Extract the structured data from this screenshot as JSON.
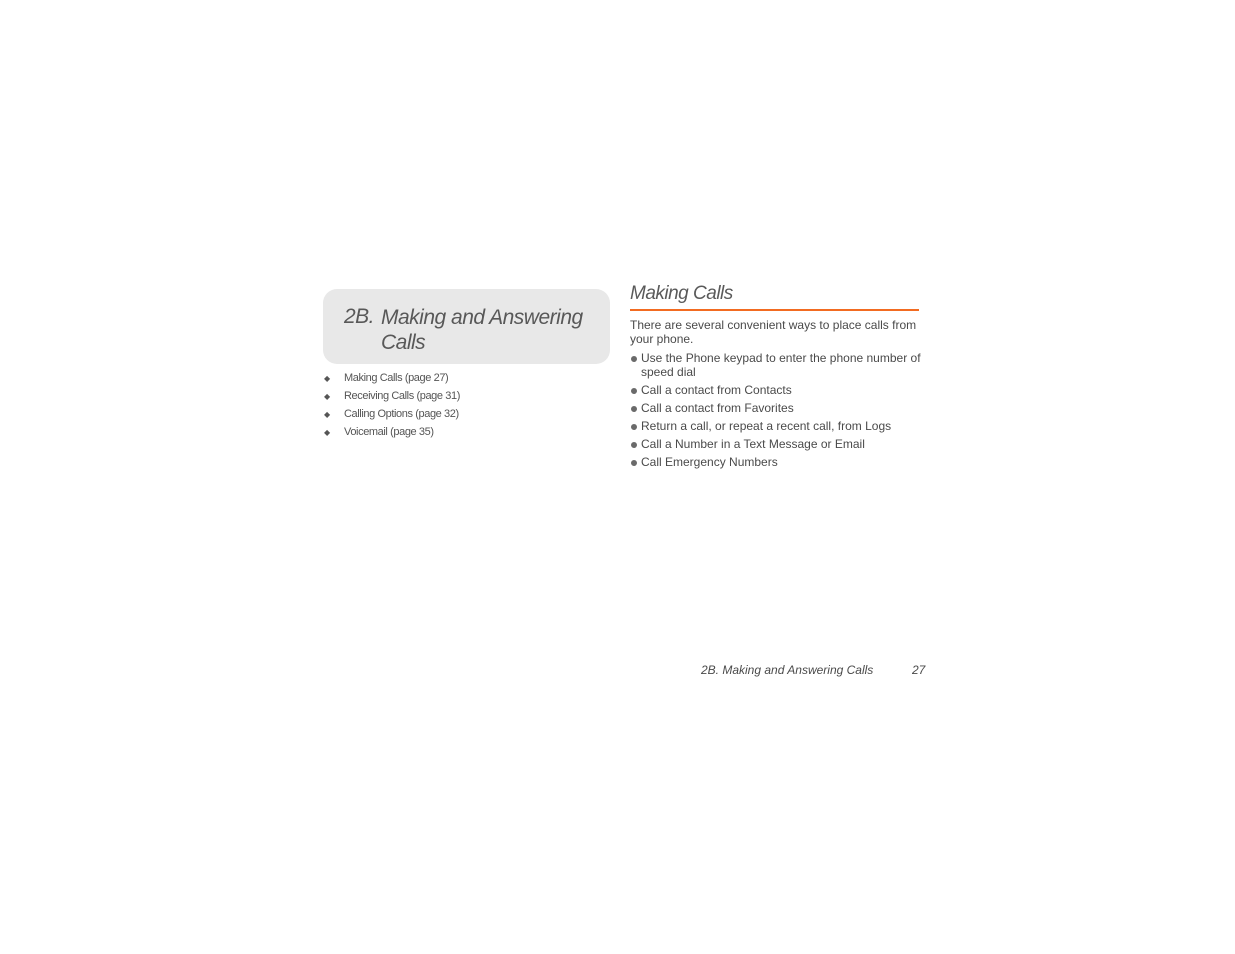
{
  "chapter": {
    "number": "2B.",
    "title": "Making and Answering Calls"
  },
  "toc": [
    {
      "label": "Making Calls (page 27)"
    },
    {
      "label": "Receiving Calls (page 31)"
    },
    {
      "label": "Calling Options (page 32)"
    },
    {
      "label": "Voicemail (page 35)"
    }
  ],
  "section": {
    "title": "Making Calls",
    "accent_color": "#f26b21",
    "intro": "There are several convenient ways to place calls from your phone.",
    "bullets": [
      "Use the Phone keypad to enter the phone number of speed dial",
      "Call a contact from Contacts",
      "Call a contact from Favorites",
      "Return a call, or repeat a recent call, from Logs",
      "Call a Number in a Text Message or Email",
      "Call Emergency Numbers"
    ]
  },
  "footer": {
    "chapter_title": "2B. Making and Answering Calls",
    "page_number": "27"
  }
}
